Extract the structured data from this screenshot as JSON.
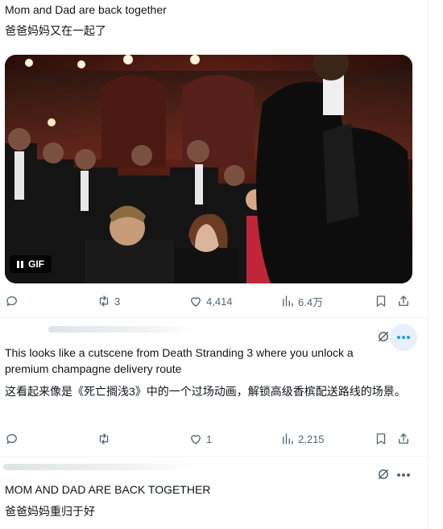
{
  "tweets": [
    {
      "text_en": "Mom and Dad are back together",
      "text_zh": "爸爸妈妈又在一起了",
      "media_badge": "GIF",
      "replies": "",
      "reposts": "3",
      "likes": "4,414",
      "views": "6.4万"
    },
    {
      "text_en": "This looks like a cutscene from Death Stranding 3 where you unlock a premium champagne delivery route",
      "text_zh": "这看起来像是《死亡搁浅3》中的一个过场动画，解锁高级香槟配送路线的场景。",
      "replies": "",
      "reposts": "",
      "likes": "1",
      "views": "2,215"
    },
    {
      "text_en": "MOM AND DAD ARE BACK TOGETHER",
      "text_zh": "爸爸妈妈重归于好"
    }
  ],
  "colors": {
    "text": "#0f1419",
    "muted": "#536471",
    "accent": "#1d9bf0",
    "divider": "#eff3f4"
  },
  "icons": [
    "reply-icon",
    "repost-icon",
    "like-icon",
    "views-icon",
    "bookmark-icon",
    "share-icon",
    "grok-icon",
    "more-icon",
    "pause-icon"
  ]
}
